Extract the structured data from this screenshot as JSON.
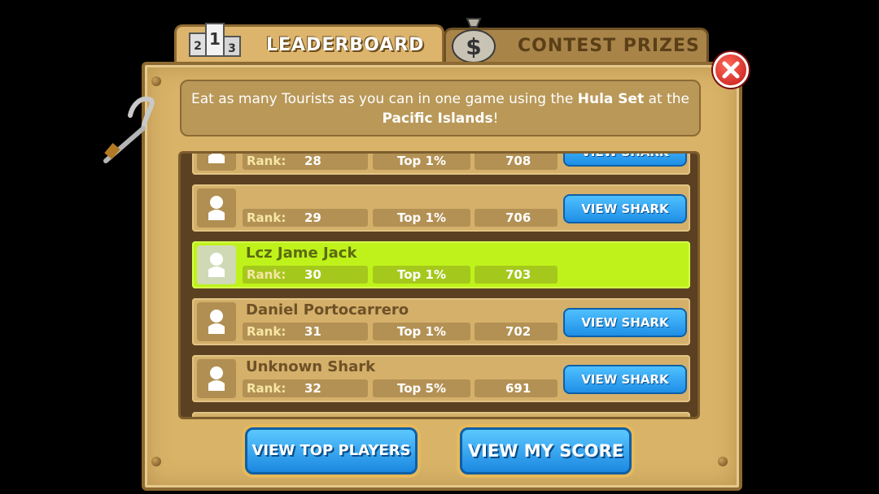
{
  "tabs": {
    "leaderboard": "LEADERBOARD",
    "prizes": "CONTEST PRIZES"
  },
  "description": {
    "part1": "Eat as many Tourists as you can in one game using the ",
    "set": "Hula Set",
    "part2": " at the",
    "location": "Pacific Islands",
    "end": "!"
  },
  "rank_label": "Rank:",
  "rows": [
    {
      "name": "",
      "rank": "28",
      "top": "Top 1%",
      "score": "708",
      "button": "VIEW SHARK"
    },
    {
      "name": "",
      "rank": "29",
      "top": "Top 1%",
      "score": "706",
      "button": "VIEW SHARK"
    },
    {
      "name": "Lcz Jame Jack",
      "rank": "30",
      "top": "Top 1%",
      "score": "703",
      "button": ""
    },
    {
      "name": "Daniel Portocarrero",
      "rank": "31",
      "top": "Top 1%",
      "score": "702",
      "button": "VIEW SHARK"
    },
    {
      "name": "Unknown Shark",
      "rank": "32",
      "top": "Top 5%",
      "score": "691",
      "button": "VIEW SHARK"
    }
  ],
  "buttons": {
    "top_players": "VIEW TOP PLAYERS",
    "my_score": "VIEW MY SCORE"
  },
  "colors": {
    "highlight": "#bff21a",
    "panel": "#d8b368",
    "button_blue": "#1f8fe6"
  }
}
